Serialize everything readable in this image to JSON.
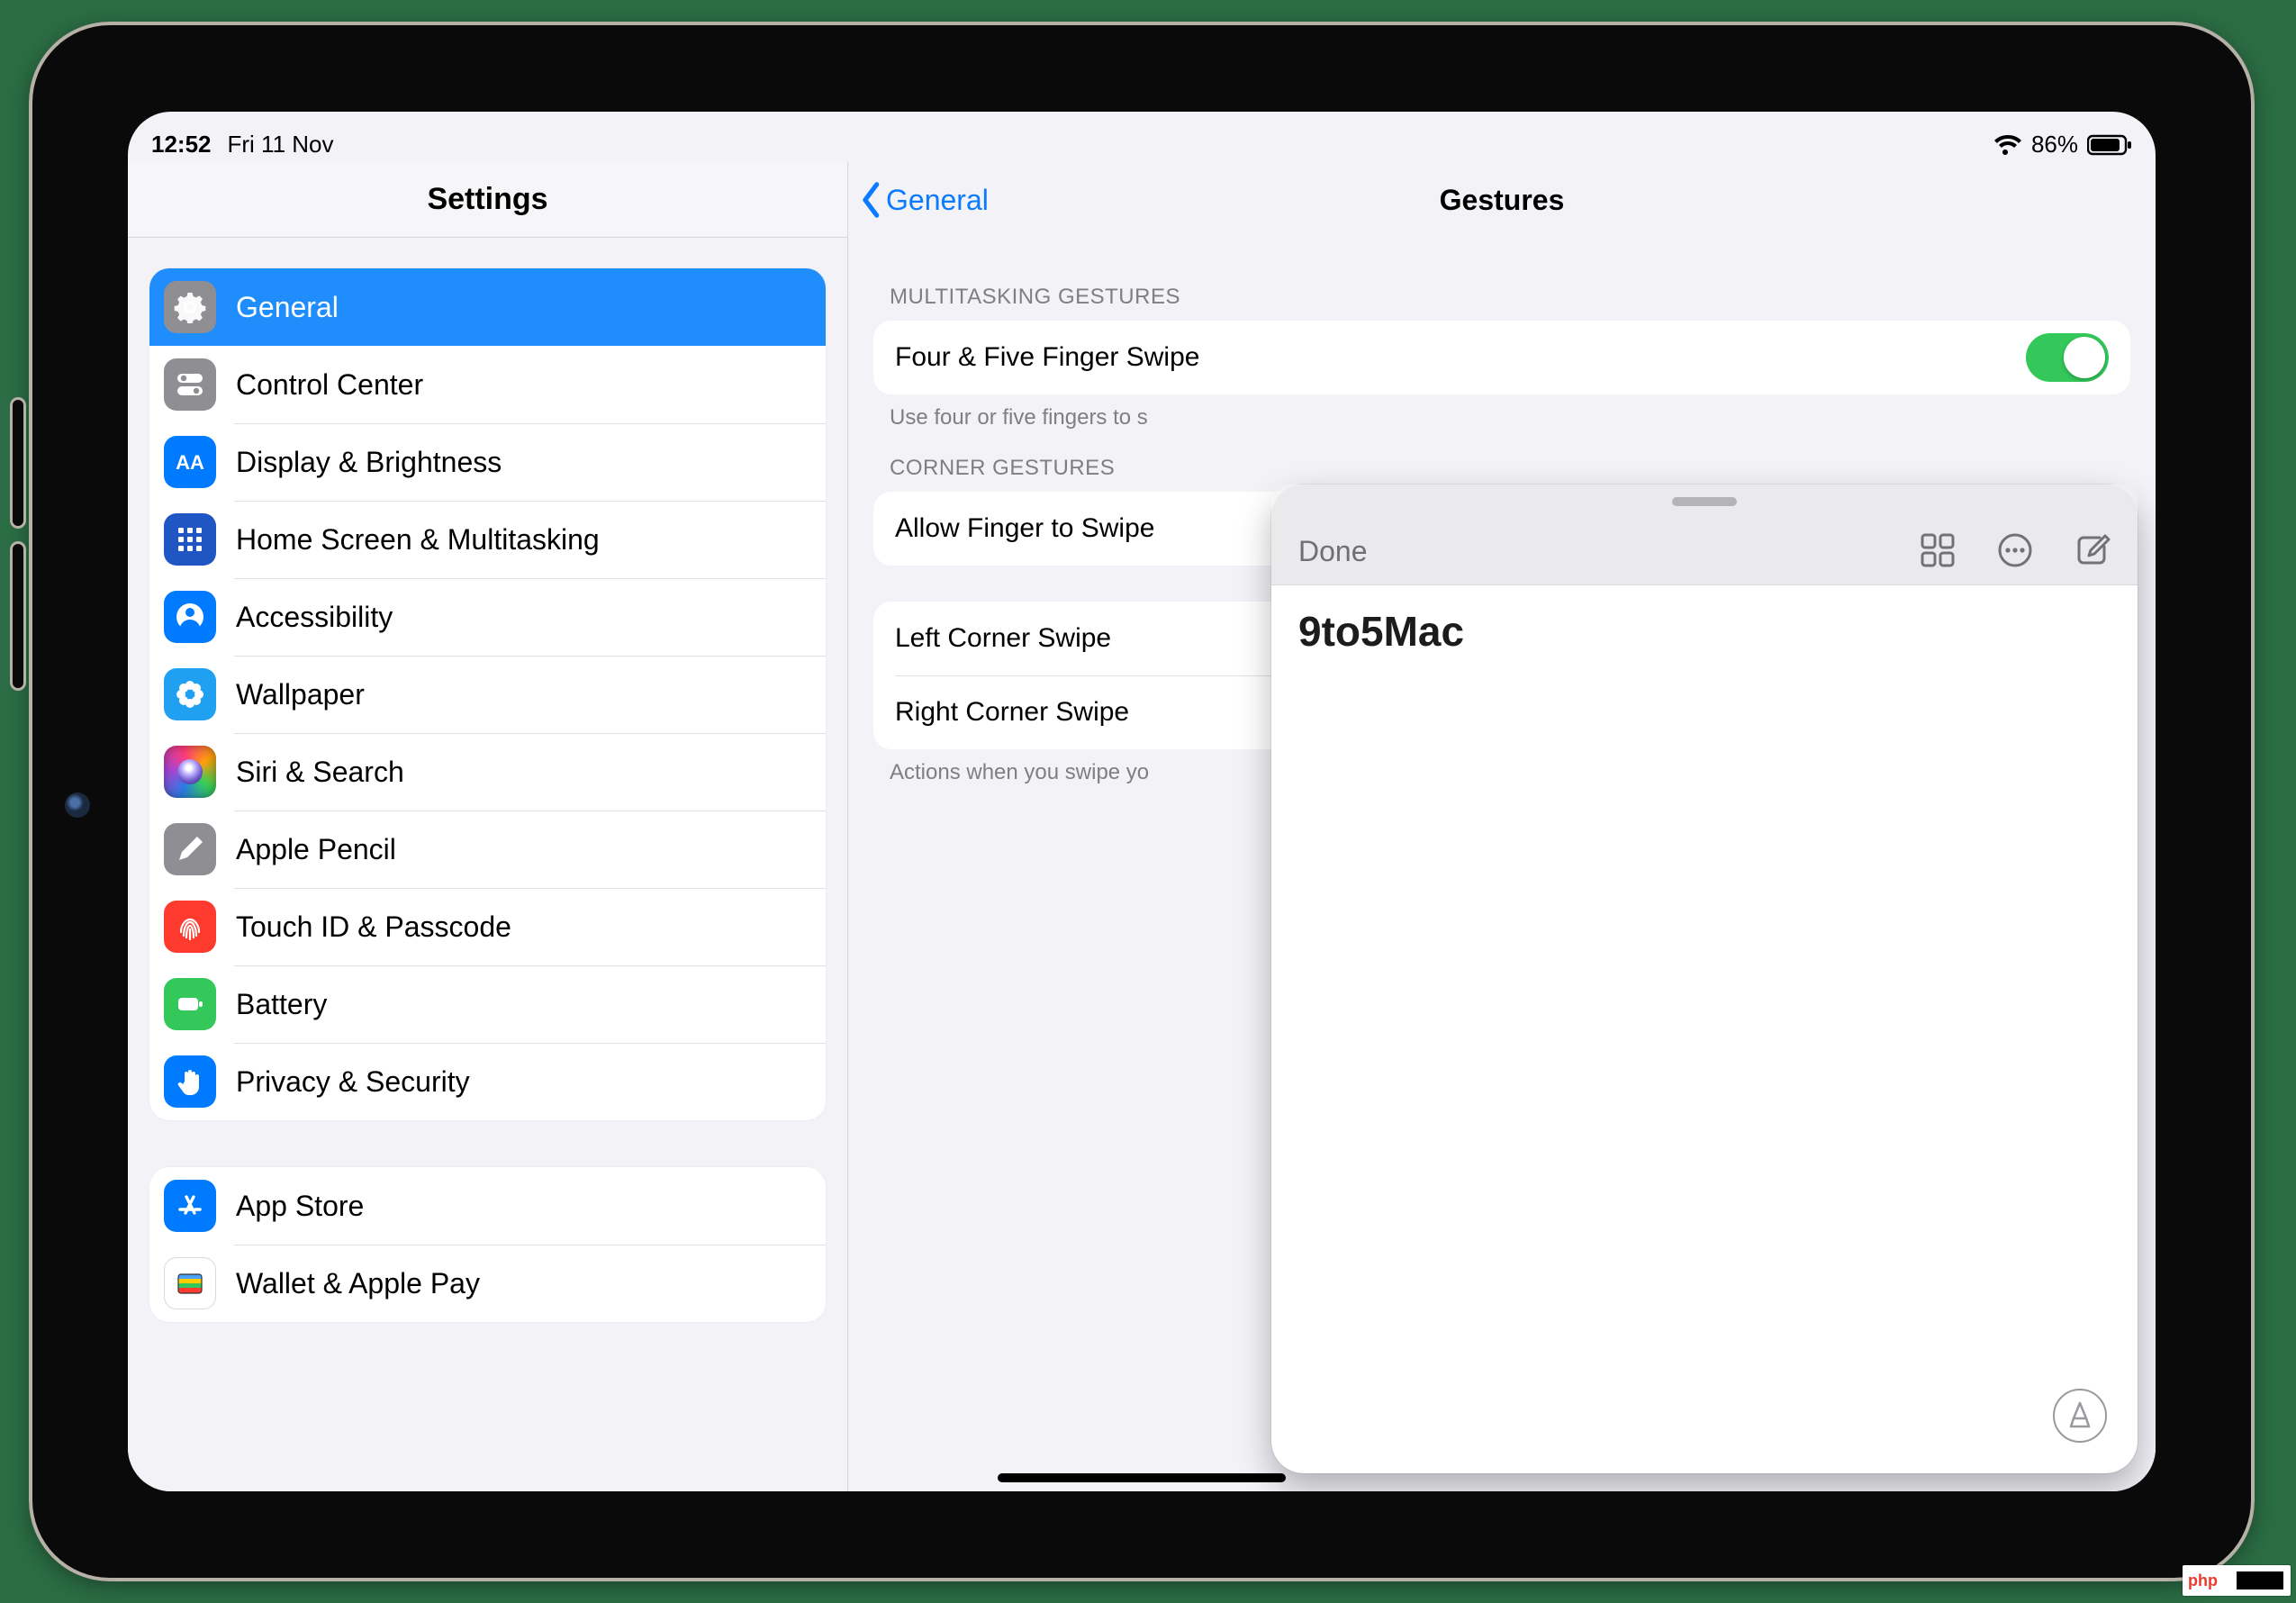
{
  "status": {
    "time": "12:52",
    "date": "Fri 11 Nov",
    "battery_pct": "86%"
  },
  "sidebar": {
    "title": "Settings",
    "group1": [
      {
        "label": "General",
        "icon": "gear",
        "bg": "bg-gray",
        "selected": true
      },
      {
        "label": "Control Center",
        "icon": "switches",
        "bg": "bg-gray",
        "selected": false
      },
      {
        "label": "Display & Brightness",
        "icon": "aa",
        "bg": "bg-blue",
        "selected": false
      },
      {
        "label": "Home Screen & Multitasking",
        "icon": "grid",
        "bg": "bg-darkblue",
        "selected": false
      },
      {
        "label": "Accessibility",
        "icon": "person",
        "bg": "bg-blue",
        "selected": false
      },
      {
        "label": "Wallpaper",
        "icon": "flower",
        "bg": "bg-cyan",
        "selected": false
      },
      {
        "label": "Siri & Search",
        "icon": "siri",
        "bg": "bg-grad-siri",
        "selected": false
      },
      {
        "label": "Apple Pencil",
        "icon": "pencil",
        "bg": "bg-gray",
        "selected": false
      },
      {
        "label": "Touch ID & Passcode",
        "icon": "fingerprint",
        "bg": "bg-red",
        "selected": false
      },
      {
        "label": "Battery",
        "icon": "battery",
        "bg": "bg-green",
        "selected": false
      },
      {
        "label": "Privacy & Security",
        "icon": "hand",
        "bg": "bg-blue",
        "selected": false
      }
    ],
    "group2": [
      {
        "label": "App Store",
        "icon": "appstore",
        "bg": "bg-blue",
        "selected": false
      },
      {
        "label": "Wallet & Apple Pay",
        "icon": "wallet",
        "bg": "bg-white",
        "selected": false
      }
    ]
  },
  "detail": {
    "back_label": "General",
    "title": "Gestures",
    "section_multitasking_header": "MULTITASKING GESTURES",
    "row_four_five": "Four & Five Finger Swipe",
    "footer_four_five": "Use four or five fingers to s",
    "section_corner_header": "CORNER GESTURES",
    "row_allow_finger": "Allow Finger to Swipe",
    "row_left_corner": "Left Corner Swipe",
    "row_right_corner": "Right Corner Swipe",
    "footer_actions": "Actions when you swipe yo"
  },
  "quicknote": {
    "done": "Done",
    "title": "9to5Mac"
  },
  "watermark": {
    "text": "php"
  }
}
